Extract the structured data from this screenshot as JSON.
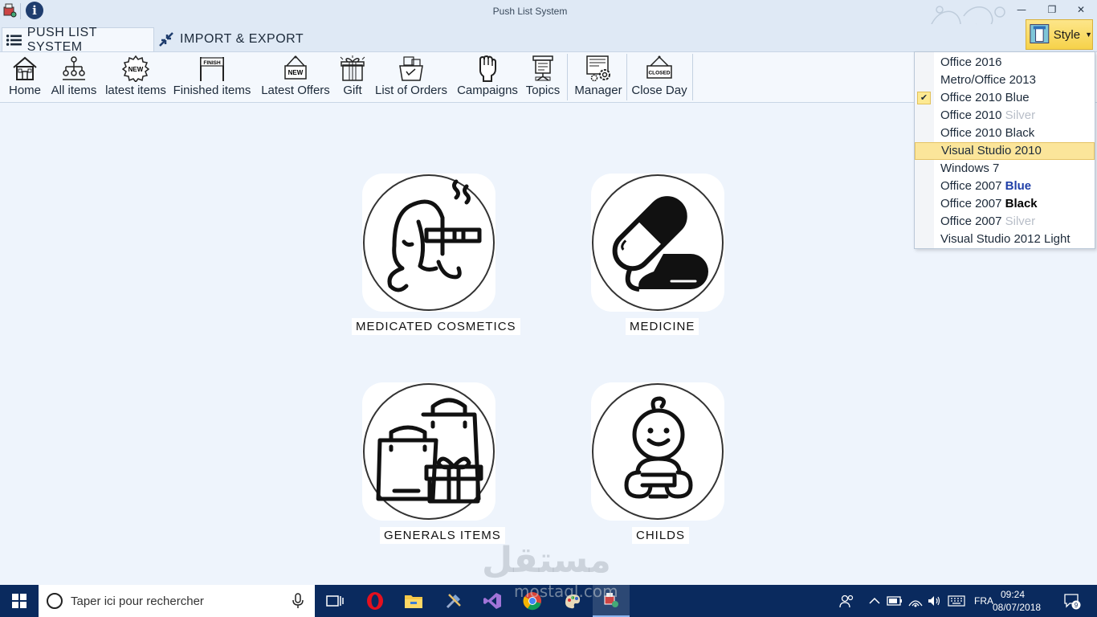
{
  "window": {
    "title": "Push List System",
    "info_glyph": "i"
  },
  "tabs": [
    {
      "label": "PUSH LIST SYSTEM",
      "icon": "menu-icon",
      "active": true
    },
    {
      "label": "IMPORT & EXPORT",
      "icon": "arrows-in-icon",
      "active": false
    }
  ],
  "style_button": {
    "label": "Style"
  },
  "ribbon": [
    {
      "label": "Home",
      "icon": "house-icon"
    },
    {
      "label": "All items",
      "icon": "hierarchy-icon"
    },
    {
      "label": "latest items",
      "icon": "new-badge-icon",
      "badge": "NEW"
    },
    {
      "label": "Finished items",
      "icon": "finish-flag-icon",
      "badge": "FINISH"
    },
    {
      "label": "Latest Offers",
      "icon": "new-sign-icon",
      "badge": "NEW"
    },
    {
      "label": "Gift",
      "icon": "gift-icon"
    },
    {
      "label": "List of Orders",
      "icon": "shopping-basket-icon"
    },
    {
      "label": "Campaigns",
      "icon": "raised-fist-icon"
    },
    {
      "label": "Topics",
      "icon": "presentation-icon"
    },
    {
      "label": "Manager",
      "icon": "monitor-gear-icon"
    },
    {
      "label": "Close Day",
      "icon": "closed-sign-icon",
      "badge": "CLOSED"
    }
  ],
  "style_menu": [
    {
      "parts": [
        {
          "t": "Office 2016",
          "c": ""
        }
      ]
    },
    {
      "parts": [
        {
          "t": "Metro/Office 2013",
          "c": ""
        }
      ]
    },
    {
      "parts": [
        {
          "t": "Office 2010 Blue",
          "c": ""
        }
      ],
      "checked": true
    },
    {
      "parts": [
        {
          "t": "Office 2010 ",
          "c": ""
        },
        {
          "t": "Silver",
          "c": "silver"
        }
      ]
    },
    {
      "parts": [
        {
          "t": "Office 2010 Black",
          "c": ""
        }
      ]
    },
    {
      "parts": [
        {
          "t": "Visual Studio 2010",
          "c": ""
        }
      ],
      "hover": true
    },
    {
      "parts": [
        {
          "t": "Windows 7",
          "c": ""
        }
      ]
    },
    {
      "parts": [
        {
          "t": "Office 2007 ",
          "c": ""
        },
        {
          "t": "Blue",
          "c": "blue"
        }
      ]
    },
    {
      "parts": [
        {
          "t": "Office 2007 ",
          "c": ""
        },
        {
          "t": "Black",
          "c": "black"
        }
      ]
    },
    {
      "parts": [
        {
          "t": "Office 2007 ",
          "c": ""
        },
        {
          "t": "Silver",
          "c": "silver"
        }
      ]
    },
    {
      "parts": [
        {
          "t": "Visual Studio 2012 Light",
          "c": ""
        }
      ]
    }
  ],
  "categories": [
    {
      "label": "MEDICATED COSMETICS",
      "icon": "cosmetics-woman-icon"
    },
    {
      "label": "MEDICINE",
      "icon": "capsule-icon"
    },
    {
      "label": "GENERALS ITEMS",
      "icon": "shopping-bags-icon"
    },
    {
      "label": "CHILDS",
      "icon": "baby-icon"
    }
  ],
  "watermark": {
    "text": "مستقل",
    "sub": "mostaql.com"
  },
  "taskbar": {
    "search_placeholder": "Taper ici pour rechercher",
    "apps": [
      "task-view-icon",
      "opera-icon",
      "file-explorer-icon",
      "tools-icon",
      "visual-studio-icon",
      "chrome-icon",
      "paint-icon",
      "app-active-icon"
    ],
    "language": "FRA",
    "time": "09:24",
    "date": "08/07/2018",
    "notifications": "9"
  },
  "colors": {
    "titlebar": "#dfe9f5",
    "ribbon": "#f4f8fd",
    "content": "#eef4fc",
    "style_button": "#f6d24a",
    "taskbar": "#0a2a5e",
    "menu_hover": "#fbe59a"
  }
}
